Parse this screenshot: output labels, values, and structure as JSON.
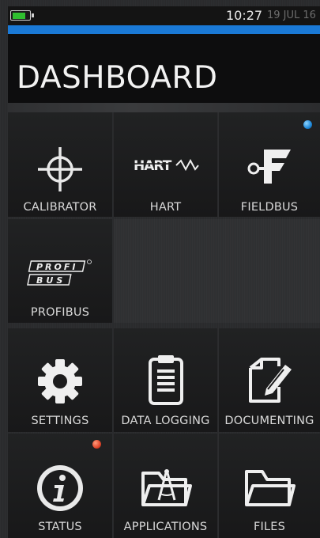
{
  "status_bar": {
    "time": "10:27",
    "date": "19 JUL 16",
    "battery_icon": "battery-icon",
    "battery_color": "#2fbf2f",
    "battery_level": 0.7
  },
  "accent_color": "#1a79d6",
  "header": {
    "title": "DASHBOARD"
  },
  "tiles": {
    "calibrator": {
      "label": "CALIBRATOR",
      "icon": "crosshair-icon"
    },
    "hart": {
      "label": "HART",
      "icon": "hart-logo-icon",
      "logo_text": "HART"
    },
    "fieldbus": {
      "label": "FIELDBUS",
      "icon": "fieldbus-icon",
      "indicator_color": "#1d86d8"
    },
    "profibus": {
      "label": "PROFIBUS",
      "icon": "profibus-logo-icon",
      "logo_top": "PROFI",
      "logo_bottom": "BUS"
    },
    "settings": {
      "label": "SETTINGS",
      "icon": "gear-icon"
    },
    "data_logging": {
      "label": "DATA LOGGING",
      "icon": "clipboard-icon"
    },
    "documenting": {
      "label": "DOCUMENTING",
      "icon": "document-pen-icon"
    },
    "status": {
      "label": "STATUS",
      "icon": "info-icon",
      "indicator_color": "#e0452a"
    },
    "applications": {
      "label": "APPLICATIONS",
      "icon": "folder-compass-icon"
    },
    "files": {
      "label": "FILES",
      "icon": "folder-icon"
    }
  }
}
